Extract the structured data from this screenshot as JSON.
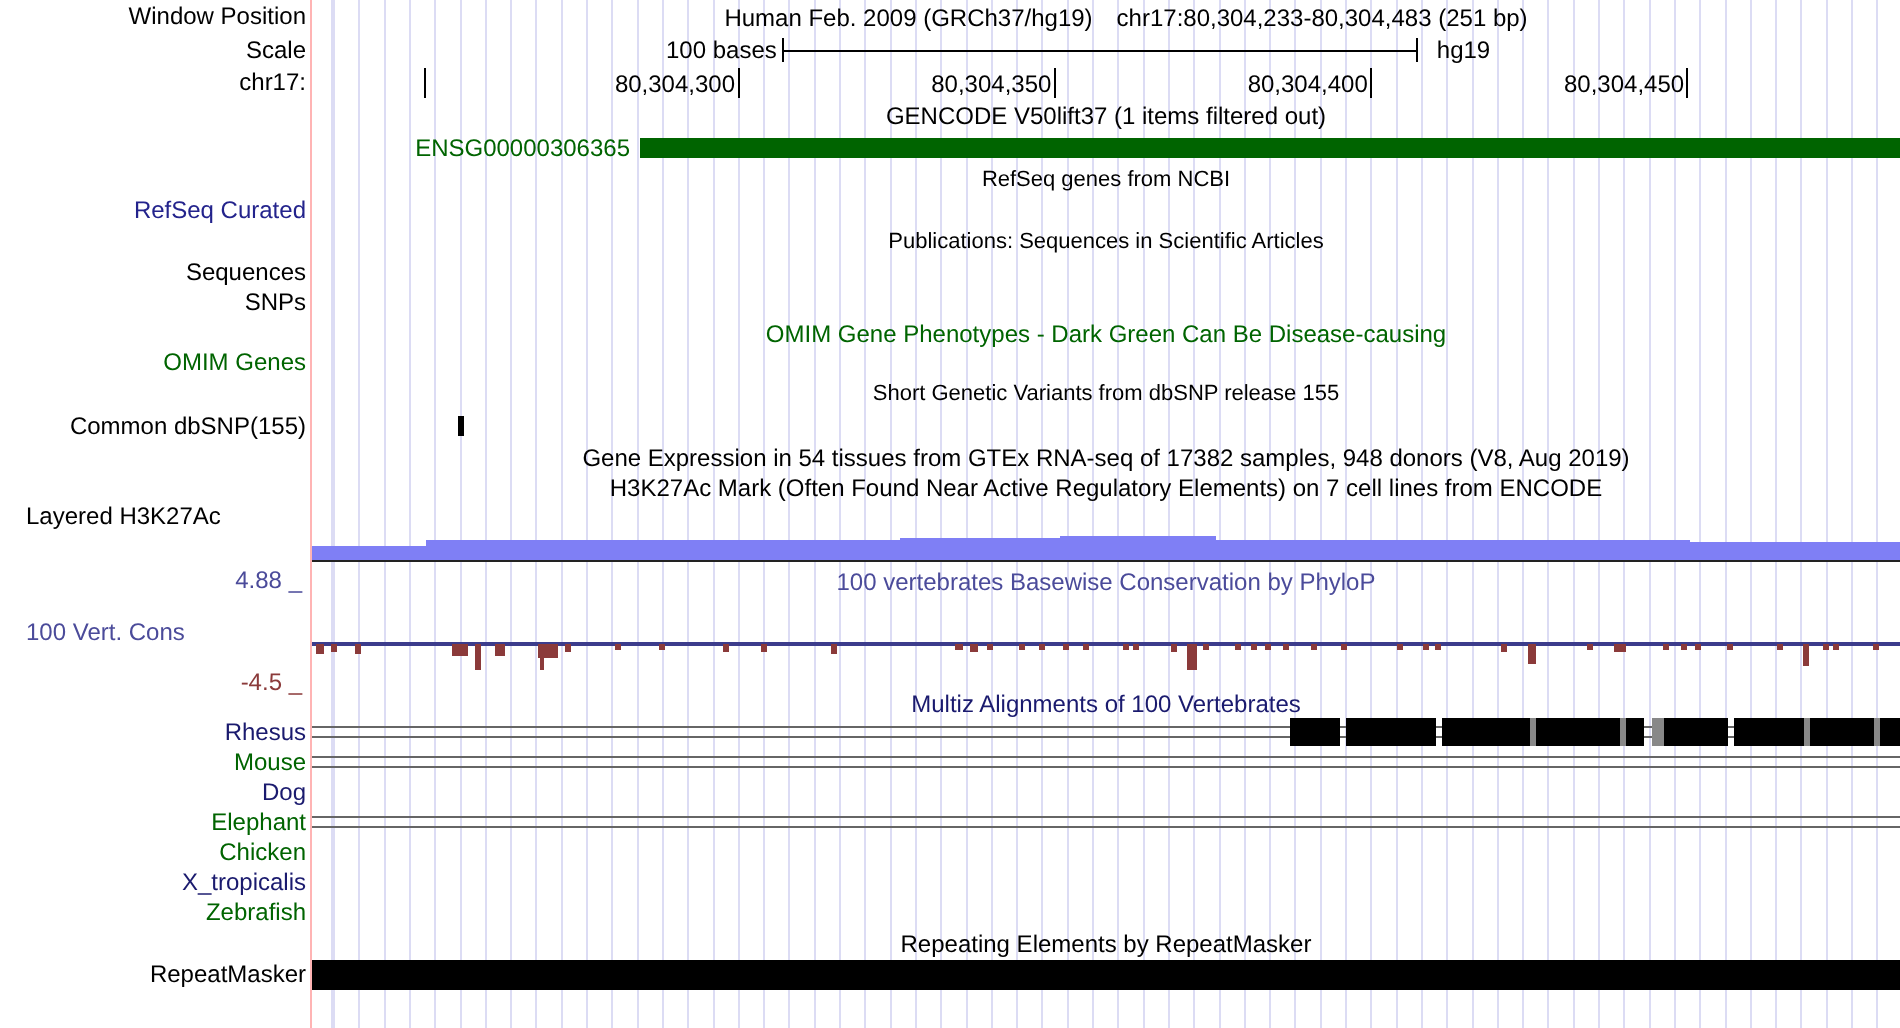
{
  "header": {
    "position_label": "Window Position",
    "assembly": "Human Feb. 2009 (GRCh37/hg19)",
    "position": "chr17:80,304,233-80,304,483 (251 bp)",
    "scale_label": "Scale",
    "scale_text": "100 bases",
    "scale_db": "hg19",
    "chrom_label": "chr17:",
    "ticks": [
      "80,304,300",
      "80,304,350",
      "80,304,400",
      "80,304,450"
    ]
  },
  "rows": [
    {
      "kind": "title",
      "text": "GENCODE V50lift37 (1 items filtered out)",
      "color": "#000000"
    },
    {
      "kind": "gene",
      "name": "ENSG00000306365",
      "color": "#006400"
    },
    {
      "kind": "note",
      "text": "RefSeq genes from NCBI"
    },
    {
      "kind": "label",
      "label": "RefSeq Curated",
      "color": "#23238c"
    },
    {
      "kind": "note",
      "text": "Publications: Sequences in Scientific Articles"
    },
    {
      "kind": "label",
      "label": "Sequences",
      "color": "#000000"
    },
    {
      "kind": "label",
      "label": "SNPs",
      "color": "#000000"
    },
    {
      "kind": "title",
      "text": "OMIM Gene Phenotypes - Dark Green Can Be Disease-causing",
      "color": "#006400"
    },
    {
      "kind": "label",
      "label": "OMIM Genes",
      "color": "#006400"
    },
    {
      "kind": "note",
      "text": "Short Genetic Variants from dbSNP release 155"
    },
    {
      "kind": "snp",
      "label": "Common dbSNP(155)",
      "color": "#000000"
    },
    {
      "kind": "title",
      "text": "Gene Expression in 54 tissues from GTEx RNA-seq of 17382 samples, 948 donors (V8, Aug 2019)",
      "color": "#000000"
    },
    {
      "kind": "title",
      "text": "H3K27Ac Mark (Often Found Near Active Regulatory Elements) on 7 cell lines from ENCODE",
      "color": "#000000"
    },
    {
      "kind": "signal",
      "label": "Layered H3K27Ac",
      "color": "#000000"
    },
    {
      "kind": "wiggle",
      "label": "100 Vert. Cons",
      "max": "4.88 _",
      "min": "-4.5 _",
      "text": "100 vertebrates Basewise Conservation by PhyloP",
      "color": "#4b4b9a"
    },
    {
      "kind": "title",
      "text": "Multiz Alignments of 100 Vertebrates",
      "color": "#1a1a6e"
    },
    {
      "kind": "partial",
      "label": "Rhesus",
      "color": "#1a1a6e"
    },
    {
      "kind": "aligned",
      "label": "Mouse",
      "color": "#006400"
    },
    {
      "kind": "unaligned",
      "label": "Dog",
      "color": "#1a1a6e"
    },
    {
      "kind": "aligned",
      "label": "Elephant",
      "color": "#006400"
    },
    {
      "kind": "unaligned",
      "label": "Chicken",
      "color": "#006400"
    },
    {
      "kind": "unaligned",
      "label": "X_tropicalis",
      "color": "#1a1a6e"
    },
    {
      "kind": "unaligned",
      "label": "Zebrafish",
      "color": "#006400"
    },
    {
      "kind": "title",
      "text": "Repeating Elements by RepeatMasker",
      "color": "#000000"
    },
    {
      "kind": "repeat",
      "label": "RepeatMasker",
      "color": "#000000"
    }
  ]
}
